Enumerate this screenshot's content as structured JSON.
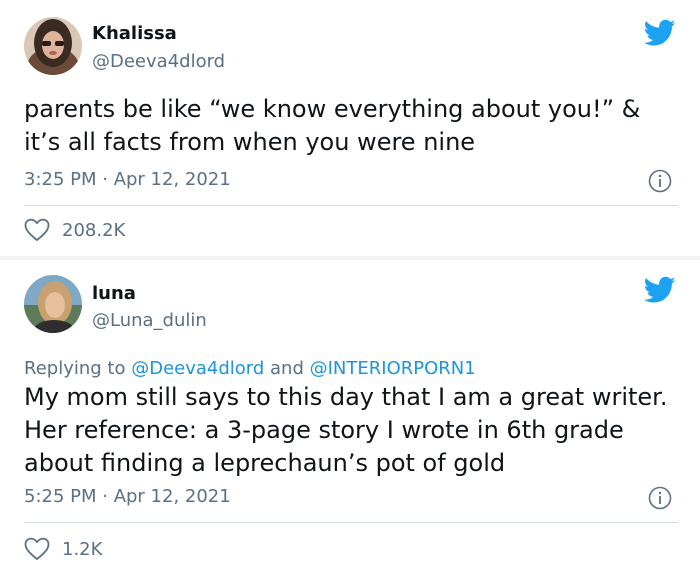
{
  "tweets": [
    {
      "author_name": "Khalissa",
      "author_handle": "@Deeva4dlord",
      "text": "parents be like “we know everything about you!” & it’s all facts from when you were nine",
      "timestamp": "3:25 PM · Apr 12, 2021",
      "likes": "208.2K",
      "avatar_icon": "avatar-photo",
      "bird_icon": "twitter-bird-icon"
    },
    {
      "author_name": "luna",
      "author_handle": "@Luna_dulin",
      "reply_prefix": "Replying to ",
      "reply_mention_1": "@Deeva4dlord",
      "reply_and": " and ",
      "reply_mention_2": "@INTERIORPORN1",
      "text": "My mom still says to this day that I am a great writer. Her reference: a 3-page story I wrote in 6th grade about finding a leprechaun’s pot of gold",
      "timestamp": "5:25 PM · Apr 12, 2021",
      "likes": "1.2K",
      "avatar_icon": "avatar-photo",
      "bird_icon": "twitter-bird-icon"
    }
  ],
  "colors": {
    "twitter_blue": "#1da1f2",
    "mention_blue": "#1b95e0",
    "secondary_text": "#5b7083",
    "primary_text": "#0f1419"
  }
}
